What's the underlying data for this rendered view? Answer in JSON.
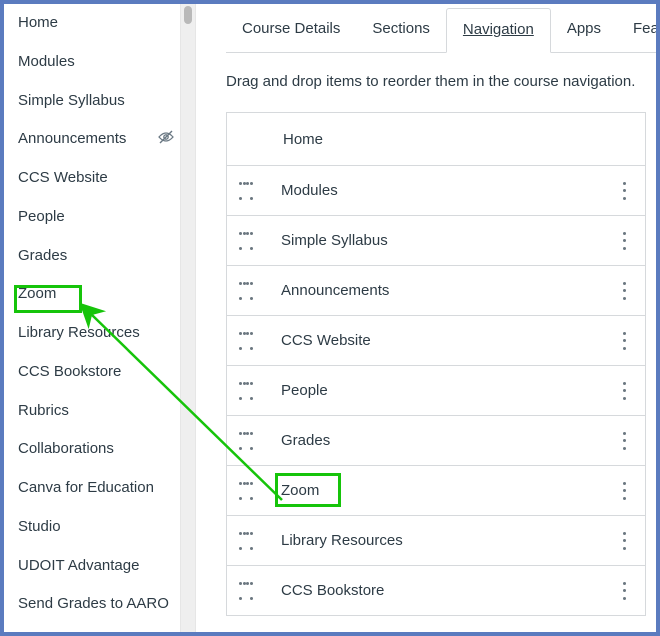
{
  "sidebar": {
    "items": [
      {
        "label": "Home"
      },
      {
        "label": "Modules"
      },
      {
        "label": "Simple Syllabus"
      },
      {
        "label": "Announcements",
        "hidden_icon": "hidden"
      },
      {
        "label": "CCS Website"
      },
      {
        "label": "People"
      },
      {
        "label": "Grades"
      },
      {
        "label": "Zoom",
        "highlighted": true
      },
      {
        "label": "Library Resources"
      },
      {
        "label": "CCS Bookstore"
      },
      {
        "label": "Rubrics"
      },
      {
        "label": "Collaborations"
      },
      {
        "label": "Canva for Education"
      },
      {
        "label": "Studio"
      },
      {
        "label": "UDOIT Advantage"
      },
      {
        "label": "Send Grades to AARO"
      }
    ]
  },
  "tabs": [
    {
      "label": "Course Details"
    },
    {
      "label": "Sections"
    },
    {
      "label": "Navigation",
      "active": true
    },
    {
      "label": "Apps"
    },
    {
      "label": "Featu"
    }
  ],
  "help_text": "Drag and drop items to reorder them in the course navigation.",
  "nav_items": [
    {
      "label": "Home",
      "locked": true
    },
    {
      "label": "Modules"
    },
    {
      "label": "Simple Syllabus"
    },
    {
      "label": "Announcements"
    },
    {
      "label": "CCS Website"
    },
    {
      "label": "People"
    },
    {
      "label": "Grades"
    },
    {
      "label": "Zoom",
      "highlighted": true
    },
    {
      "label": "Library Resources"
    },
    {
      "label": "CCS Bookstore"
    }
  ],
  "annotation": {
    "color": "#16c40a"
  }
}
